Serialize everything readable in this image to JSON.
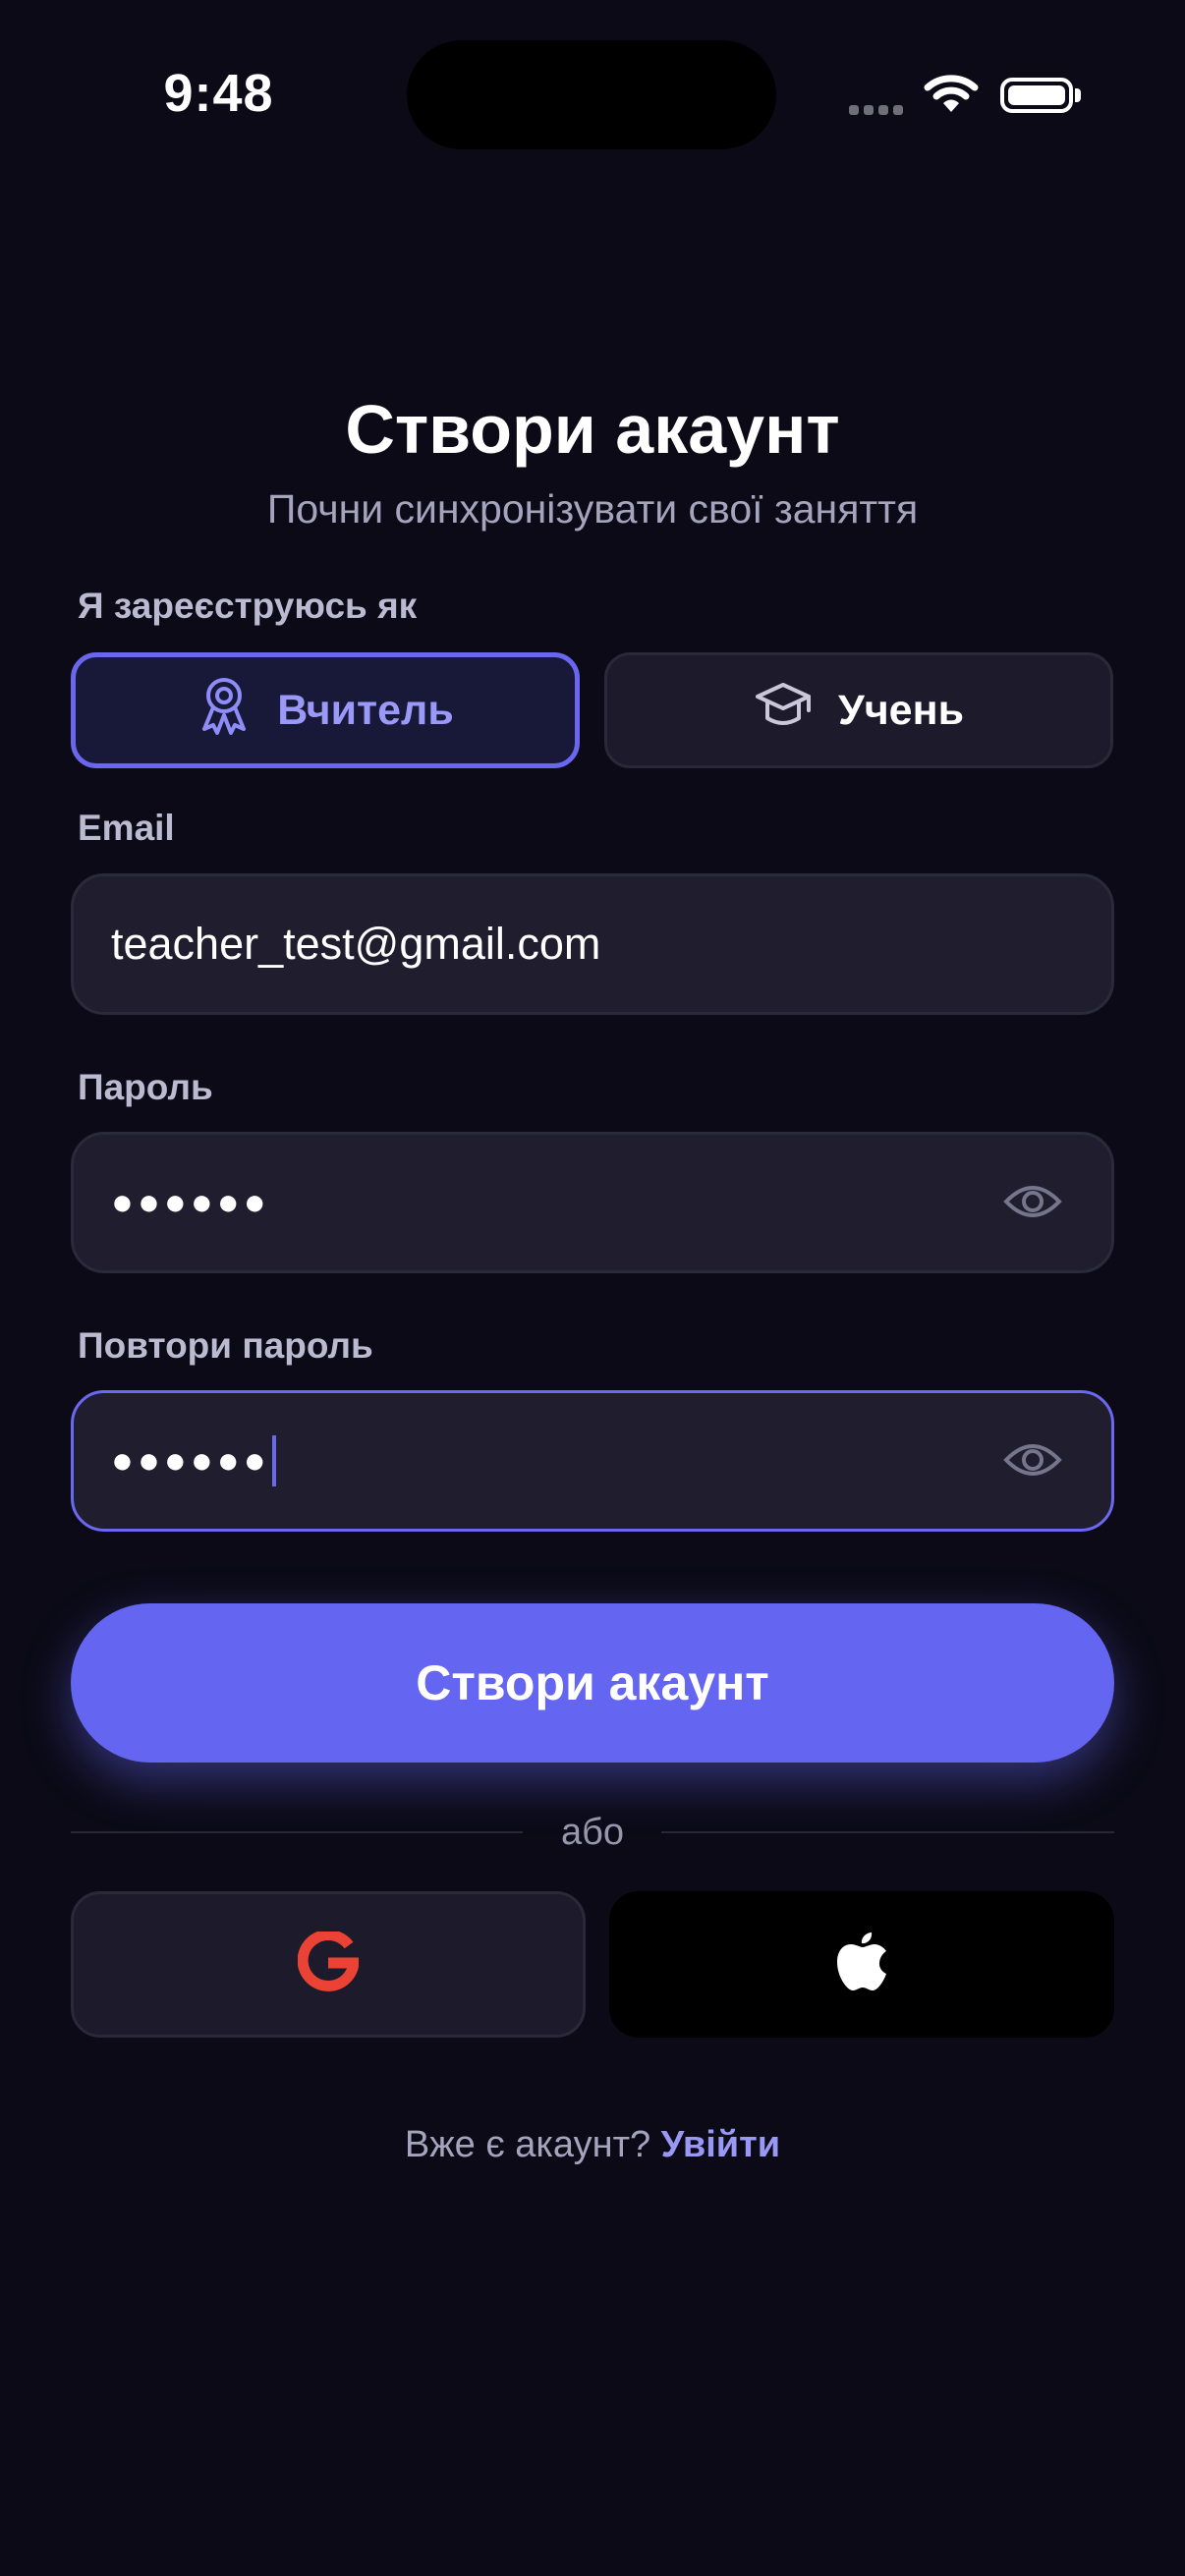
{
  "status_bar": {
    "time": "9:48"
  },
  "header": {
    "title": "Створи акаунт",
    "subtitle": "Почни синхронізувати свої заняття"
  },
  "role": {
    "label": "Я зареєструюсь як",
    "options": [
      {
        "label": "Вчитель",
        "icon": "award-ribbon-icon",
        "selected": true
      },
      {
        "label": "Учень",
        "icon": "graduation-cap-icon",
        "selected": false
      }
    ]
  },
  "email": {
    "label": "Email",
    "value": "teacher_test@gmail.com"
  },
  "password": {
    "label": "Пароль",
    "value": "●●●●●●"
  },
  "password_repeat": {
    "label": "Повтори пароль",
    "value": "●●●●●●"
  },
  "submit": {
    "label": "Створи акаунт"
  },
  "divider": {
    "text": "або"
  },
  "social": {
    "google": {
      "letter": "G"
    },
    "apple": {
      "icon": "apple-icon"
    }
  },
  "footer": {
    "prompt": "Вже є акаунт?",
    "link": "Увійти"
  },
  "colors": {
    "background": "#0b0a16",
    "accent": "#6466f1",
    "field": "#1f1d2e",
    "google_red": "#ea4335"
  }
}
